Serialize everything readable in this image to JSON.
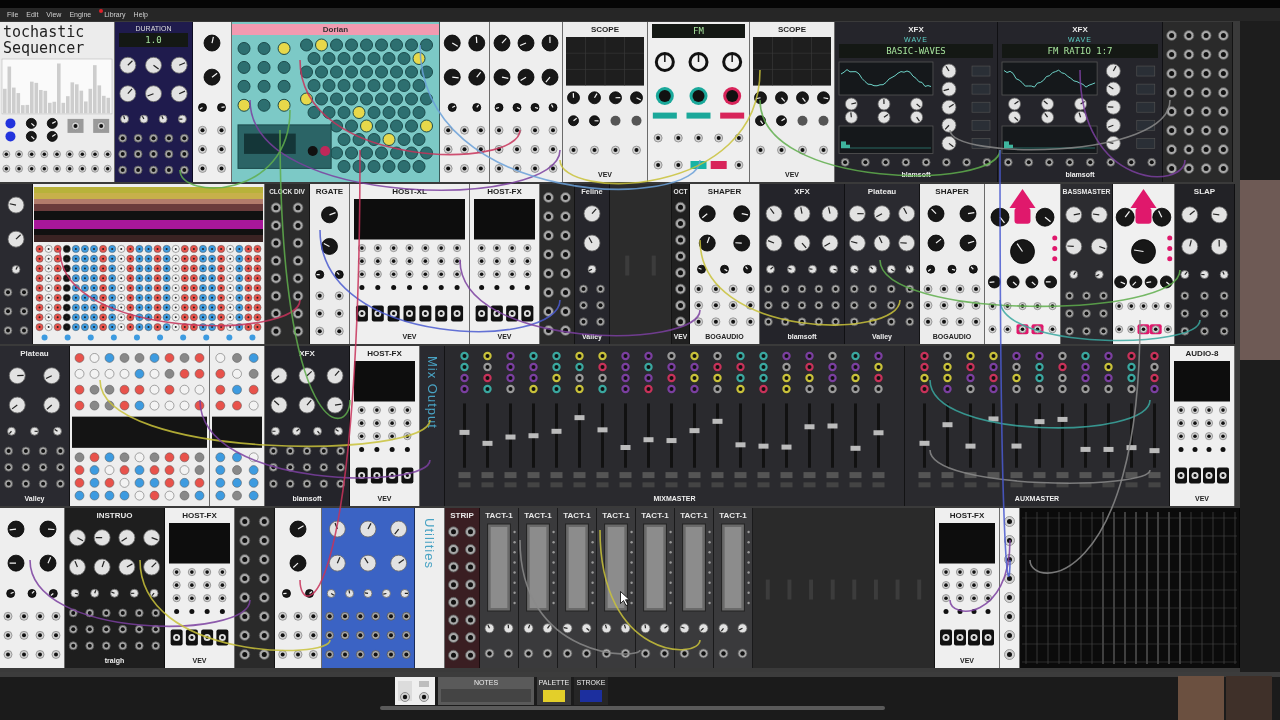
{
  "menu": [
    {
      "label": "File",
      "notification": false
    },
    {
      "label": "Edit",
      "notification": false
    },
    {
      "label": "View",
      "notification": false
    },
    {
      "label": "Engine",
      "notification": false
    },
    {
      "label": "Library",
      "notification": true
    },
    {
      "label": "Help",
      "notification": false
    }
  ],
  "rack": {
    "rows": [
      {
        "modules": [
          {
            "kind": "sequencer",
            "title": "tochastic Sequencer",
            "color": "#ececec"
          },
          {
            "kind": "knobs",
            "display_label": "DURATION",
            "display": "1.0",
            "color": "#1f1b4d"
          },
          {
            "kind": "knobs",
            "color": "#efefef"
          },
          {
            "kind": "hexgrid",
            "title": "Dorian",
            "color": "#7cc9c6"
          },
          {
            "kind": "knobs",
            "color": "#eeeeee"
          },
          {
            "kind": "knobs",
            "color": "#eeeeee"
          },
          {
            "kind": "scope",
            "title": "SCOPE",
            "brand": "VEV",
            "color": "#ededed"
          },
          {
            "kind": "display",
            "display": "FM",
            "color": "#efefef"
          },
          {
            "kind": "scope",
            "title": "SCOPE",
            "brand": "VEV",
            "color": "#ededed"
          },
          {
            "kind": "wave",
            "title": "XFX",
            "subtitle": "WAVE",
            "display": "BASIC-WAVES",
            "brand": "blamsoft",
            "color": "#25252b"
          },
          {
            "kind": "wave",
            "title": "XFX",
            "subtitle": "WAVE",
            "display": "FM RATIO 1:7",
            "brand": "blamsoft",
            "color": "#25252b"
          },
          {
            "kind": "jacks",
            "color": "#2a2a2a"
          }
        ]
      },
      {
        "modules": [
          {
            "kind": "knobs",
            "color": "#2a2a30"
          },
          {
            "kind": "musicalbox",
            "color": "#eeeeee"
          },
          {
            "kind": "jacks",
            "title": "CLOCK DIV",
            "color": "#2b2b2b"
          },
          {
            "kind": "knobs",
            "title": "RGATE",
            "color": "#ececec"
          },
          {
            "kind": "host",
            "title": "HOST-XL",
            "brand": "VEV",
            "color": "#efefef"
          },
          {
            "kind": "host",
            "title": "HOST-FX",
            "brand": "VEV",
            "color": "#efefef"
          },
          {
            "kind": "jacks",
            "color": "#2a2a2a"
          },
          {
            "kind": "knobs",
            "title": "Feline",
            "brand": "Valley",
            "color": "#26262c"
          },
          {
            "kind": "blank",
            "color": "#2c2c2c"
          },
          {
            "kind": "jacks",
            "title": "OCT",
            "brand": "VEV",
            "color": "#202020"
          },
          {
            "kind": "knobs",
            "title": "SHAPER",
            "brand": "BOGAUDIO",
            "color": "#ececec"
          },
          {
            "kind": "knobs",
            "title": "XFX",
            "brand": "blamsoft",
            "color": "#24242a"
          },
          {
            "kind": "knobs",
            "title": "Plateau",
            "brand": "Valley",
            "color": "#2a2a30"
          },
          {
            "kind": "knobs",
            "title": "SHAPER",
            "brand": "BOGAUDIO",
            "color": "#ececec"
          },
          {
            "kind": "pink",
            "color": "#f0f0f0"
          },
          {
            "kind": "knobs",
            "title": "BASSMASTER",
            "color": "#2c2c30"
          },
          {
            "kind": "pink",
            "color": "#f0f0f0"
          },
          {
            "kind": "knobs",
            "title": "SLAP",
            "color": "#222226"
          }
        ]
      },
      {
        "modules": [
          {
            "kind": "knobs",
            "title": "Plateau",
            "brand": "Valley",
            "color": "#2a2a30"
          },
          {
            "kind": "panelgrid",
            "color": "#eeeeee"
          },
          {
            "kind": "panelgrid",
            "color": "#eeeeee"
          },
          {
            "kind": "knobs",
            "title": "XFX",
            "brand": "blamsoft",
            "color": "#24242a"
          },
          {
            "kind": "host",
            "title": "HOST-FX",
            "brand": "VEV",
            "color": "#efefef"
          },
          {
            "kind": "vertical",
            "title": "Mix Output",
            "color": "#2a2a30"
          },
          {
            "kind": "mixer",
            "brand": "MIXMASTER",
            "color": "#2a2a2e"
          },
          {
            "kind": "mixer",
            "brand": "AUXMASTER",
            "color": "#2a2a2e"
          },
          {
            "kind": "host",
            "title": "AUDIO-8",
            "brand": "VEV",
            "color": "#efefef"
          }
        ]
      },
      {
        "modules": [
          {
            "kind": "knobs",
            "color": "#eeeeee"
          },
          {
            "kind": "knobs",
            "title": "INSTRUO",
            "brand": "traigh",
            "color": "#1e1e1e"
          },
          {
            "kind": "host",
            "title": "HOST-FX",
            "brand": "VEV",
            "color": "#efefef"
          },
          {
            "kind": "jacks",
            "color": "#2a2a2a"
          },
          {
            "kind": "knobs",
            "color": "#eeeeee"
          },
          {
            "kind": "knobs",
            "color": "#3b63c4"
          },
          {
            "kind": "vertical",
            "title": "Utilities",
            "color": "#eeeeee"
          },
          {
            "kind": "jacks",
            "title": "STRIP",
            "color": "#3a1e22"
          },
          {
            "kind": "tact",
            "title": "TACT-1",
            "color": "#3a3a3c"
          },
          {
            "kind": "tact",
            "title": "TACT-1",
            "color": "#3a3a3c"
          },
          {
            "kind": "tact",
            "title": "TACT-1",
            "color": "#3a3a3c"
          },
          {
            "kind": "tact",
            "title": "TACT-1",
            "color": "#3a3a3c"
          },
          {
            "kind": "tact",
            "title": "TACT-1",
            "color": "#3a3a3c"
          },
          {
            "kind": "tact",
            "title": "TACT-1",
            "color": "#3a3a3c"
          },
          {
            "kind": "tact",
            "title": "TACT-1",
            "color": "#3a3a3c"
          },
          {
            "kind": "blank",
            "color": "#2a2a2a"
          },
          {
            "kind": "host",
            "title": "HOST-FX",
            "brand": "VEV",
            "color": "#efefef"
          },
          {
            "kind": "jacks",
            "color": "#f0f0f0"
          },
          {
            "kind": "grid",
            "color": "#0b0b0b"
          }
        ]
      }
    ]
  },
  "toolbar": {
    "notes": {
      "label": "NOTES"
    },
    "palette": {
      "label": "PALETTE",
      "color": "#e3cf2a"
    },
    "stroke": {
      "label": "STROKE",
      "color": "#1c2f9e"
    }
  }
}
